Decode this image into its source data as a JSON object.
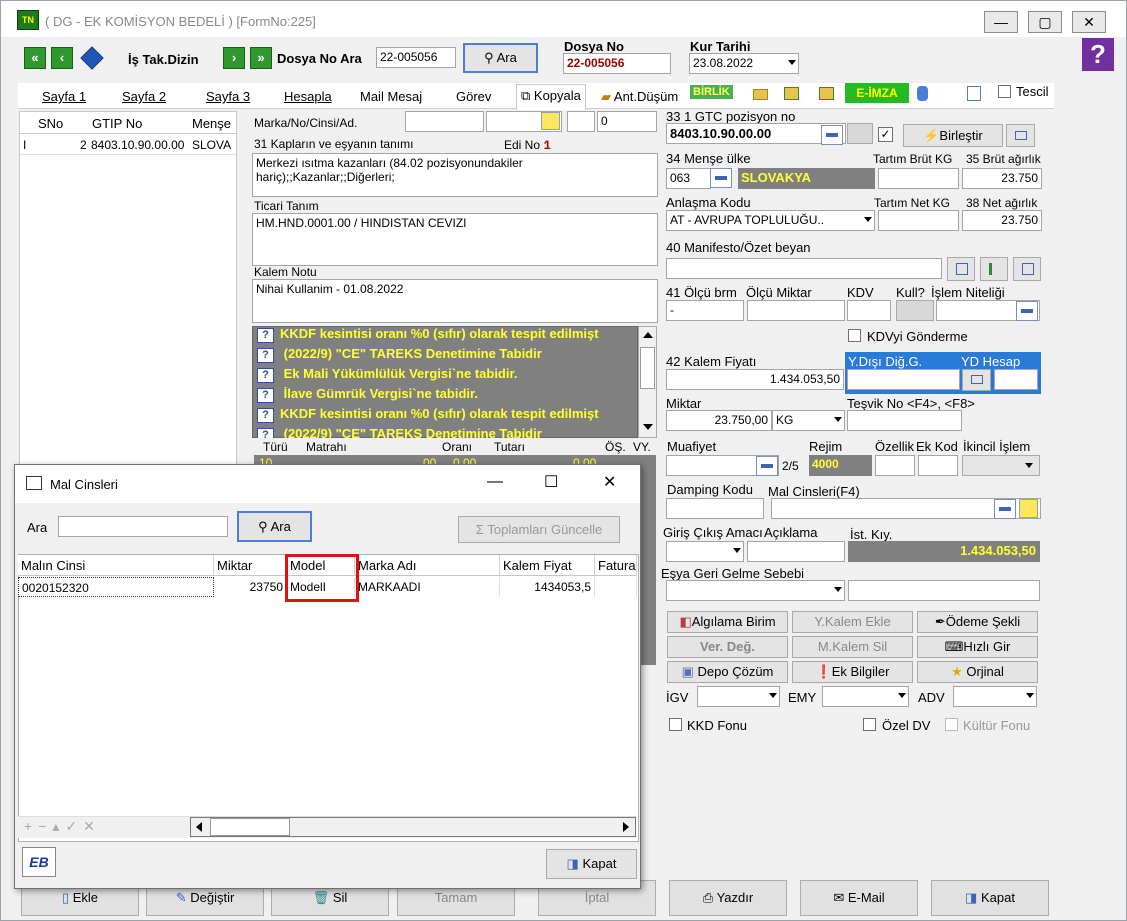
{
  "title": "( DG  - EK KOMİSYON BEDELİ ) [FormNo:225]",
  "toolbar": {
    "is_tak_dizin": "İş Tak.Dizin",
    "dosya_no_ara": "Dosya No Ara",
    "dosya_input": "22-005056",
    "ara": "Ara",
    "dosya_no_label": "Dosya No",
    "dosya_no_value": "22-005056",
    "kur_tarihi_label": "Kur Tarihi",
    "kur_tarihi_value": "23.08.2022"
  },
  "tabs": [
    "Sayfa 1",
    "Sayfa 2",
    "Sayfa 3",
    "Hesapla",
    "Mail Mesaj",
    "Görev",
    "Kopyala",
    "Ant.Düşüm",
    "BİRLİK",
    "E-İMZA",
    "Tescil"
  ],
  "left_grid": {
    "headers": [
      "SNo",
      "GTIP No",
      "Menşe"
    ],
    "row": [
      "I",
      "2",
      "8403.10.90.00.00",
      "SLOVA"
    ]
  },
  "form": {
    "marka_label": "Marka/No/Cinsi/Ad.",
    "marka_val4": "0",
    "kaplar_label": "31 Kapların ve eşyanın tanımı",
    "edi_label": "Edi No :",
    "edi_value": "1",
    "kaplar_text": "Merkezi ısıtma kazanları (84.02 pozisyonundakiler hariç);;Kazanlar;;Diğerleri;",
    "ticari_label": "Ticari Tanım",
    "ticari_text": "HM.HND.0001.00 / HINDISTAN CEVIZI",
    "kalem_notu_label": "Kalem Notu",
    "kalem_notu_text": "Nihai Kullanim - 01.08.2022",
    "messages": [
      "KKDF kesintisi oranı %0 (sıfır) olarak tespit edilmişt",
      "  (2022/9) \"CE\" TAREKS Denetimine Tabidir",
      "  Ek Mali Yükümlülük Vergisi`ne tabidir.",
      "  İlave Gümrük Vergisi`ne tabidir.",
      "KKDF kesintisi oranı %0 (sıfır) olarak tespit edilmişt",
      "  (2022/9) \"CE\" TAREKS Denetimine Tabidir"
    ],
    "tax_headers": [
      "Türü",
      "Matrahı",
      "Oranı",
      "Tutarı",
      "ÖŞ.",
      "VY."
    ],
    "tax_row": [
      "10",
      "00",
      "0,00",
      "0,00"
    ]
  },
  "right": {
    "gtc_label": "33 1 GTC pozisyon no",
    "gtc_value": "8403.10.90.00.00",
    "birlestir": "Birleştir",
    "mense_label": "34 Menşe ülke",
    "mense_code": "063",
    "mense_name": "SLOVAKYA",
    "tartim_brut_label": "Tartım Brüt KG",
    "brut_label": "35 Brüt ağırlık",
    "brut_value": "23.750",
    "anlasma_label": "Anlaşma Kodu",
    "anlasma_value": "AT    - AVRUPA TOPLULUĞU..",
    "tartim_net_label": "Tartım Net KG",
    "net_label": "38 Net ağırlık",
    "net_value": "23.750",
    "manifesto_label": "40 Manifesto/Özet beyan",
    "olcu_brm_label": "41 Ölçü brm",
    "olcu_brm_value": "-",
    "olcu_miktar_label": "Ölçü Miktar",
    "kdv_label": "KDV",
    "kull_label": "Kull?",
    "islem_label": "İşlem Niteliği",
    "kdv_gonderme": "KDVyi Gönderme",
    "kalem_fiyati_label": "42 Kalem Fiyatı",
    "kalem_fiyati_value": "1.434.053,50",
    "ydisi_label": "Y.Dışı Diğ.G.",
    "yd_hesap_label": "YD Hesap",
    "miktar_label": "Miktar",
    "miktar_value": "23.750,00",
    "miktar_unit": "KG",
    "tesvik_label": "Teşvik No <F4>, <F8>",
    "muafiyet_label": "Muafiyet",
    "muafiyet_count": "2/5",
    "rejim_label": "Rejim",
    "rejim_value": "4000",
    "ozellik_label": "Özellik",
    "ek_kod_label": "Ek Kod",
    "ikincil_label": "İkincil İşlem",
    "damping_label": "Damping Kodu",
    "mal_cinsleri_label": "Mal Cinsleri(F4)",
    "giris_label": "Giriş Çıkış Amacı",
    "aciklama_label": "Açıklama",
    "ist_kiy_label": "İst. Kıy.",
    "ist_kiy_value": "1.434.053,50",
    "esya_label": "Eşya Geri Gelme Sebebi",
    "btn_algilama": "Algılama Birim",
    "btn_ykalem": "Y.Kalem Ekle",
    "btn_odeme": "Ödeme Şekli",
    "btn_verdeg": "Ver. Değ.",
    "btn_mkalem": "M.Kalem Sil",
    "btn_hizli": "Hızlı Gir",
    "btn_depo": "Depo Çözüm",
    "btn_ekbilgi": "Ek Bilgiler",
    "btn_orjinal": "Orjinal",
    "igv_label": "İGV",
    "emy_label": "EMY",
    "adv_label": "ADV",
    "kkd_fonu": "KKD Fonu",
    "ozel_dv": "Özel DV",
    "kultur_fonu": "Kültür Fonu"
  },
  "bottom": [
    "Ekle",
    "Değiştir",
    "Sil",
    "Tamam",
    "İptal",
    "Yazdır",
    "E-Mail",
    "Kapat"
  ],
  "dialog": {
    "title": "Mal Cinsleri",
    "ara_label": "Ara",
    "ara_button": "Ara",
    "toplamlar": "Toplamları Güncelle",
    "headers": [
      "Malın Cinsi",
      "Miktar",
      "Model",
      "Marka Adı",
      "Kalem Fiyat",
      "Fatura"
    ],
    "row": [
      "0020152320",
      "23750",
      "ModelI",
      "MARKAADI",
      "1434053,5",
      ""
    ],
    "kapat": "Kapat",
    "logo": "EB"
  }
}
